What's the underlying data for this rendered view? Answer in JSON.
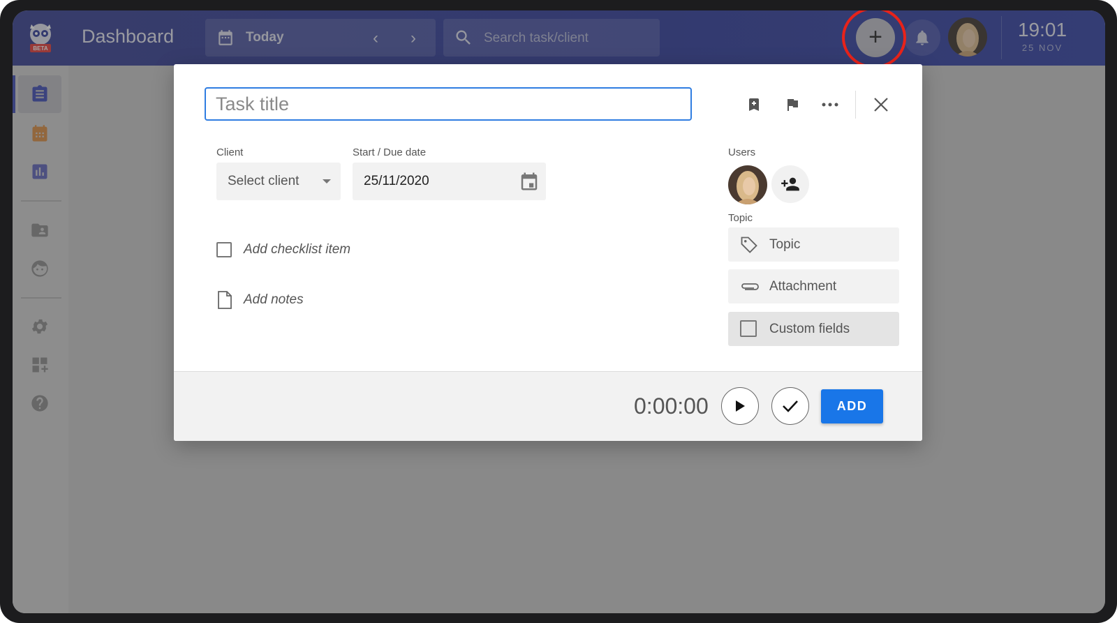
{
  "app": {
    "title": "Dashboard",
    "logo_badge": "BETA"
  },
  "topbar": {
    "date_label": "Today",
    "search_placeholder": "Search task/client",
    "clock_time": "19:01",
    "clock_date": "25 NOV",
    "accent_color": "#2f3ea3"
  },
  "sidebar": {
    "items": [
      {
        "icon": "clipboard-icon",
        "active": true
      },
      {
        "icon": "calendar-icon"
      },
      {
        "icon": "chart-icon"
      },
      {
        "icon": "folder-user-icon"
      },
      {
        "icon": "face-icon"
      },
      {
        "icon": "gear-icon"
      },
      {
        "icon": "add-widget-icon"
      },
      {
        "icon": "help-icon"
      }
    ]
  },
  "modal": {
    "title_placeholder": "Task title",
    "client_label": "Client",
    "client_value": "Select client",
    "date_label": "Start / Due date",
    "date_value": "25/11/2020",
    "checklist_placeholder": "Add checklist item",
    "notes_placeholder": "Add notes",
    "users_label": "Users",
    "topic_label": "Topic",
    "topic_button": "Topic",
    "attachment_button": "Attachment",
    "custom_fields_button": "Custom fields",
    "timer": "0:00:00",
    "add_button": "ADD",
    "add_button_color": "#1976e8"
  }
}
